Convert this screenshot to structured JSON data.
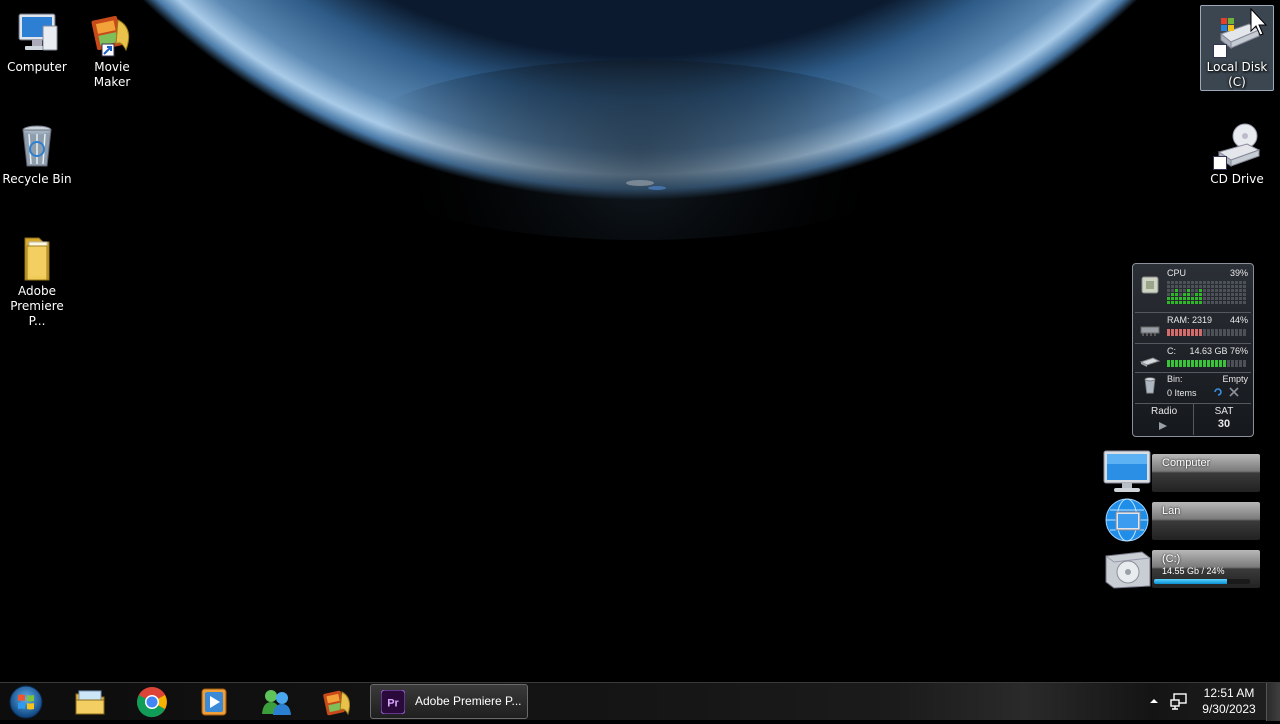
{
  "desktop": {
    "icons_left": [
      {
        "label": "Computer",
        "icon": "computer-icon"
      },
      {
        "label": "Movie Maker",
        "icon": "movie-maker-icon"
      },
      {
        "label": "Recycle Bin",
        "icon": "recycle-bin-icon"
      },
      {
        "label": "Adobe Premiere P...",
        "icon": "folder-icon"
      }
    ],
    "icons_right": [
      {
        "label": "Local Disk (C)",
        "icon": "drive-icon",
        "selected": true
      },
      {
        "label": "CD Drive",
        "icon": "cd-drive-icon"
      }
    ]
  },
  "gadget": {
    "cpu_label": "CPU",
    "cpu_percent": "39%",
    "cpu_level": 0.39,
    "ram_label": "RAM: 2319",
    "ram_percent": "44%",
    "ram_level": 0.44,
    "disk_label": "C:",
    "disk_value": "14.63 GB 76%",
    "disk_level": 0.76,
    "bin_label": "Bin:",
    "bin_status": "Empty",
    "bin_items": "0 Items",
    "radio_label": "Radio",
    "day": "SAT",
    "date": "30"
  },
  "widgets": [
    {
      "title": "Computer",
      "subtitle": "",
      "icon": "monitor-icon"
    },
    {
      "title": "Lan",
      "subtitle": "",
      "icon": "globe-network-icon"
    },
    {
      "title": "(C:)",
      "subtitle": "14.55 Gb / 24%",
      "icon": "hard-disk-icon",
      "used_level": 0.76
    }
  ],
  "taskbar": {
    "pinned": [
      "windows-explorer-icon",
      "chrome-icon",
      "media-player-icon",
      "messenger-icon",
      "movie-maker-icon"
    ],
    "active_window": {
      "label": "Adobe Premiere P...",
      "icon": "premiere-pro-icon",
      "icon_text": "Pr"
    },
    "clock_time": "12:51 AM",
    "clock_date": "9/30/2023"
  },
  "colors": {
    "cpu_bar": "#2fb82a",
    "ram_bar": "#d36b6b",
    "disk_progress": "#0a8fd0",
    "premiere": "#2a0a3a"
  }
}
